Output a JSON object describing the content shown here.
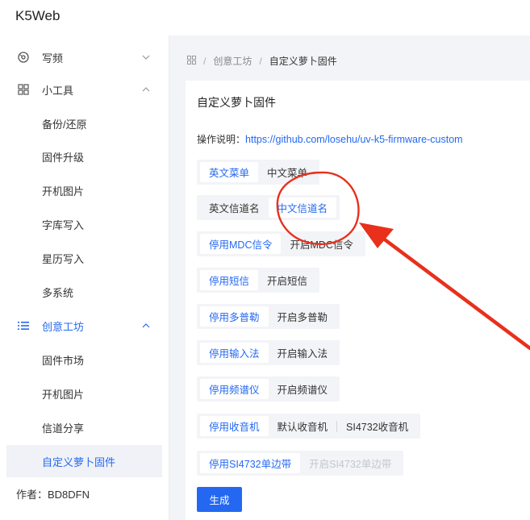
{
  "app": {
    "title": "K5Web"
  },
  "sidebar": {
    "items": [
      {
        "label": "写频",
        "icon": "disc-icon"
      },
      {
        "label": "小工具",
        "icon": "grid-icon"
      },
      {
        "label": "备份/还原"
      },
      {
        "label": "固件升级"
      },
      {
        "label": "开机图片"
      },
      {
        "label": "字库写入"
      },
      {
        "label": "星历写入"
      },
      {
        "label": "多系统"
      },
      {
        "label": "创意工坊",
        "icon": "list-icon"
      },
      {
        "label": "固件市场"
      },
      {
        "label": "开机图片"
      },
      {
        "label": "信道分享"
      },
      {
        "label": "自定义萝卜固件"
      }
    ],
    "author": "作者：BD8DFN"
  },
  "breadcrumb": {
    "items": [
      "创意工坊",
      "自定义萝卜固件"
    ],
    "separator": "/"
  },
  "card": {
    "title": "自定义萝卜固件",
    "desc_label": "操作说明：",
    "desc_link": "https://github.com/losehu/uv-k5-firmware-custom"
  },
  "options": [
    {
      "a": "英文菜单",
      "b": "中文菜单",
      "active": "a"
    },
    {
      "a": "英文信道名",
      "b": "中文信道名",
      "active": "b"
    },
    {
      "a": "停用MDC信令",
      "b": "开启MDC信令",
      "active": "a"
    },
    {
      "a": "停用短信",
      "b": "开启短信",
      "active": "a"
    },
    {
      "a": "停用多普勒",
      "b": "开启多普勒",
      "active": "a"
    },
    {
      "a": "停用输入法",
      "b": "开启输入法",
      "active": "a"
    },
    {
      "a": "停用频谱仪",
      "b": "开启频谱仪",
      "active": "a"
    },
    {
      "a": "停用收音机",
      "b": "默认收音机",
      "c": "SI4732收音机",
      "active": "a"
    },
    {
      "a": "停用SI4732单边带",
      "b": "开启SI4732单边带",
      "active": "a",
      "b_disabled": true
    }
  ],
  "generate_label": "生成",
  "colors": {
    "accent": "#2468f2",
    "annotation": "#e8301c",
    "background": "#f3f4f7"
  }
}
